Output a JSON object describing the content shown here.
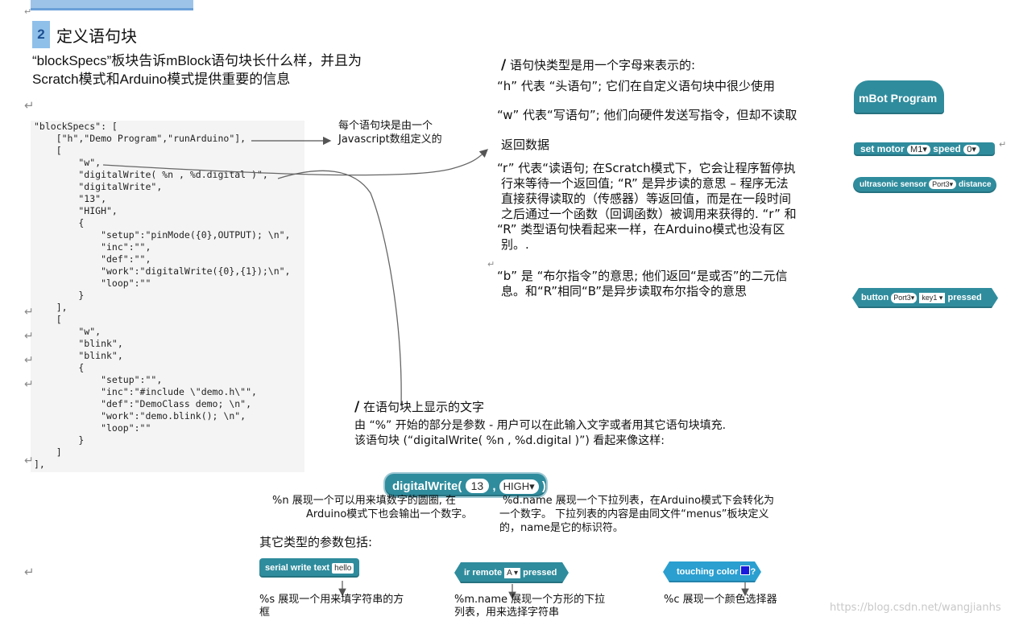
{
  "heading": {
    "number": "2",
    "title": "定义语句块"
  },
  "intro": {
    "line1": "“blockSpecs”板块告诉mBlock语句块长什么样，并且为",
    "line2": "Scratch模式和Arduino模式提供重要的信息"
  },
  "code_lines": [
    "\"blockSpecs\": [",
    "    [\"h\",\"Demo Program\",\"runArduino\"],",
    "    [",
    "        \"w\",",
    "        \"digitalWrite( %n , %d.digital )\",",
    "        \"digitalWrite\",",
    "        \"13\",",
    "        \"HIGH\",",
    "        {",
    "            \"setup\":\"pinMode({0},OUTPUT); \\n\",",
    "            \"inc\":\"\",",
    "            \"def\":\"\",",
    "            \"work\":\"digitalWrite({0},{1});\\n\",",
    "            \"loop\":\"\"",
    "        }",
    "    ],",
    "    [",
    "        \"w\",",
    "        \"blink\",",
    "        \"blink\",",
    "        {",
    "            \"setup\":\"\",",
    "            \"inc\":\"#include \\\"demo.h\\\"\",",
    "            \"def\":\"DemoClass demo; \\n\",",
    "            \"work\":\"demo.blink(); \\n\",",
    "            \"loop\":\"\"",
    "        }",
    "    ]",
    "],"
  ],
  "callout_array": {
    "line1": "每个语句块是由一个",
    "line2": "Javascript数组定义的"
  },
  "types_section": {
    "title": "语句快类型是用一个字母来表示的:",
    "h_text": "“h” 代表 “头语句”; 它们在自定义语句块中很少使用",
    "w_text": "“w” 代表“写语句”; 他们向硬件发送写指令，但却不读取",
    "w_text2": "返回数据",
    "r_lines": [
      "“r”  代表“读语句;  在Scratch模式下，它会让程序暂停执",
      "行来等待一个返回值; “R” 是异步读的意思 – 程序无法",
      "直接获得读取的（传感器）等返回值，而是在一段时间",
      "之后通过一个函数（回调函数）被调用来获得的. “r” 和",
      "“R” 类型语句快看起来一样，在Arduino模式也没有区",
      "别。."
    ],
    "b_lines": [
      "“b” 是 “布尔指令”的意思; 他们返回“是或否”的二元信",
      "息。和“R”相同“B”是异步读取布尔指令的意思"
    ]
  },
  "blocks": {
    "hat": {
      "label": "mBot Program"
    },
    "motor": {
      "label": "set motor",
      "port": "M1",
      "speed_label": "speed",
      "speed_value": "0"
    },
    "ultrasonic": {
      "label": "ultrasonic sensor",
      "port": "Port3",
      "label2": "distance"
    },
    "button": {
      "label": "button",
      "port": "Port3",
      "key": "key1",
      "label2": "pressed"
    },
    "digital": {
      "label": "digitalWrite(",
      "num": "13",
      "sep": ",",
      "value": "HIGH",
      "close": ")"
    },
    "serial": {
      "label": "serial write text",
      "value": "hello"
    },
    "irremote": {
      "label": "ir remote",
      "key": "A",
      "label2": "pressed"
    },
    "touching": {
      "label": "touching color",
      "q": "?",
      "color": "#1a1adc"
    }
  },
  "display_section": {
    "title": "在语句块上显示的文字",
    "line1": "由 “%” 开始的部分是参数 - 用户可以在此输入文字或者用其它语句块填充.",
    "line2": "该语句块 (“digitalWrite( %n , %d.digital )”) 看起来像这样:"
  },
  "notes": {
    "n_line1": "%n 展现一个可以用来填数字的圆圈, 在",
    "n_line2": "Arduino模式下也会输出一个数字。",
    "d_line1": "%d.name  展现一个下拉列表，在Arduino模式下会转化为",
    "d_line2": "一个数字。  下拉列表的内容是由同文件“menus”板块定义",
    "d_line3": "的，name是它的标识符。",
    "others_title": "其它类型的参数包括:",
    "s_line1": "%s 展现一个用来填字符串的方",
    "s_line2": "框",
    "m_line1": "%m.name 展现一个方形的下拉",
    "m_line2": "列表，用来选择字符串",
    "c_line1": "%c 展现一个颜色选择器"
  },
  "watermark": "https://blog.csdn.net/wangjianhs"
}
